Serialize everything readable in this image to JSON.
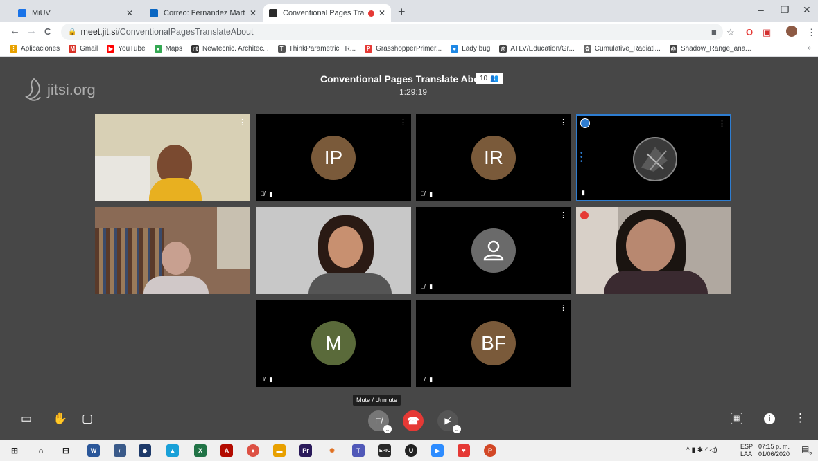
{
  "browser": {
    "tabs": [
      {
        "title": "MiUV",
        "fav_color": "#1a73e8",
        "active": false
      },
      {
        "title": "Correo: Fernandez Martinez Blan",
        "fav_color": "#0a66c2",
        "active": false
      },
      {
        "title": "Conventional Pages Translat",
        "fav_color": "#2b2b2b",
        "active": true
      }
    ],
    "new_tab": "+",
    "window": {
      "minimize": "–",
      "restore": "❐",
      "close": "✕"
    },
    "url_host": "meet.jit.si",
    "url_path": "/ConventionalPagesTranslateAbout",
    "nav": {
      "back": "←",
      "forward": "→",
      "reload": "C"
    },
    "bookmarks": [
      {
        "label": "Aplicaciones",
        "color": "#e8a100",
        "glyph": "⋮"
      },
      {
        "label": "Gmail",
        "color": "#d93025",
        "glyph": "M"
      },
      {
        "label": "YouTube",
        "color": "#ff0000",
        "glyph": "▶"
      },
      {
        "label": "Maps",
        "color": "#34a853",
        "glyph": "●"
      },
      {
        "label": "Newtecnic. Architec...",
        "color": "#333333",
        "glyph": "nt"
      },
      {
        "label": "ThinkParametric | R...",
        "color": "#555555",
        "glyph": "T"
      },
      {
        "label": "GrasshopperPrimer...",
        "color": "#e53935",
        "glyph": "P"
      },
      {
        "label": "Lady bug",
        "color": "#1e88e5",
        "glyph": "●"
      },
      {
        "label": "ATLV/Education/Gr...",
        "color": "#444444",
        "glyph": "◎"
      },
      {
        "label": "Cumulative_Radiati...",
        "color": "#666666",
        "glyph": "✿"
      },
      {
        "label": "Shadow_Range_ana...",
        "color": "#444444",
        "glyph": "◎"
      }
    ],
    "bookmarks_more": "»"
  },
  "meeting": {
    "logo_text": "jitsi.org",
    "title": "Conventional Pages Translate About",
    "participant_count": "10",
    "timer": "1:29:19",
    "tooltip": "Mute / Unmute",
    "participants": [
      {
        "initials": "",
        "kind": "video",
        "bg": "#c9c0a0"
      },
      {
        "initials": "IP",
        "kind": "avatar",
        "color": "#7a5a3a"
      },
      {
        "initials": "IR",
        "kind": "avatar",
        "color": "#7a5a3a"
      },
      {
        "initials": "",
        "kind": "photo",
        "color": "#2a2a2a"
      },
      {
        "initials": "",
        "kind": "video",
        "bg": "#8a6a55"
      },
      {
        "initials": "",
        "kind": "video",
        "bg": "#b8b8b8"
      },
      {
        "initials": "",
        "kind": "default",
        "color": "#6a6a6a"
      },
      {
        "initials": "",
        "kind": "video",
        "bg": "#a89a90"
      },
      {
        "initials": "M",
        "kind": "avatar",
        "color": "#5a6a3a"
      },
      {
        "initials": "BF",
        "kind": "avatar",
        "color": "#7a5a3a"
      }
    ]
  },
  "taskbar": {
    "tray_lang_1": "ESP",
    "tray_lang_2": "LAA",
    "time": "07:15 p. m.",
    "date": "01/06/2020",
    "notif_count": "5"
  }
}
